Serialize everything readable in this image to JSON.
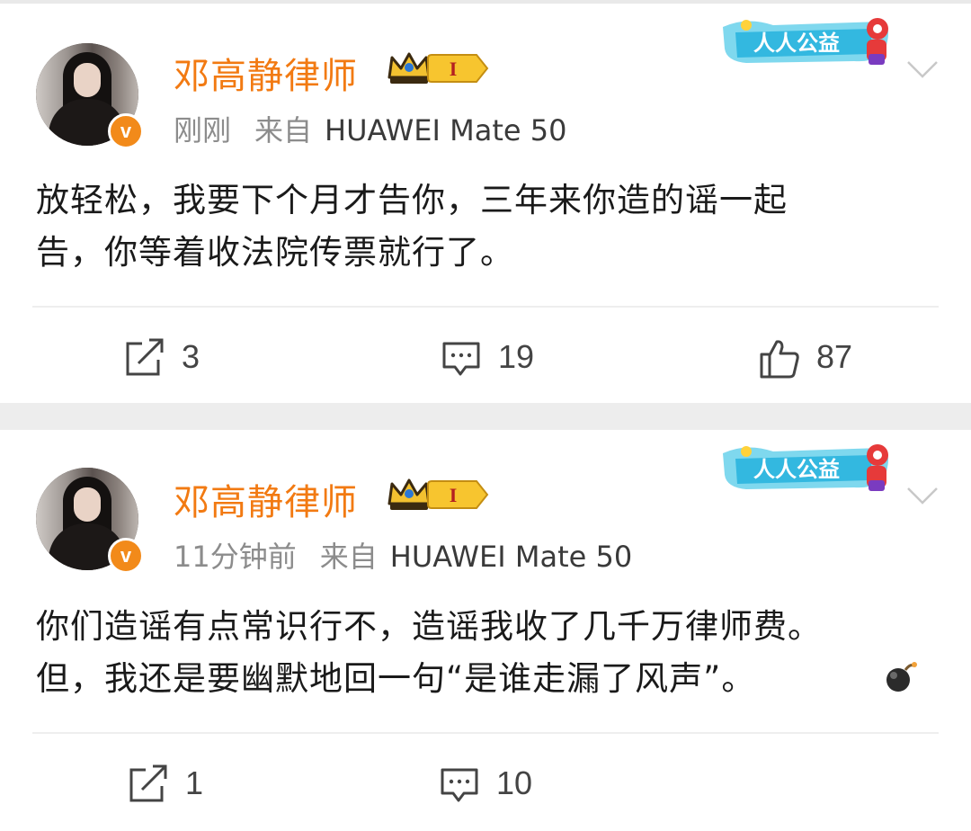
{
  "posts": [
    {
      "author": "邓高静律师",
      "level_label": "I",
      "time": "刚刚",
      "source_prefix": "来自",
      "device": "HUAWEI Mate 50",
      "charity_badge": "人人公益",
      "verified_mark": "v",
      "content_line1": "放轻松，我要下个月才告你，三年来你造的谣一起",
      "content_line2": "告，你等着收法院传票就行了。",
      "repost_count": "3",
      "comment_count": "19",
      "like_count": "87"
    },
    {
      "author": "邓高静律师",
      "level_label": "I",
      "time": "11分钟前",
      "source_prefix": "来自",
      "device": "HUAWEI Mate 50",
      "charity_badge": "人人公益",
      "verified_mark": "v",
      "content_line1": "你们造谣有点常识行不，造谣我收了几千万律师费。",
      "content_line2": "但，我还是要幽默地回一句“是谁走漏了风声”。",
      "repost_count": "1",
      "comment_count": "10"
    }
  ],
  "colors": {
    "author": "#f27a12",
    "meta": "#8c8c8c",
    "text": "#1a1a1a",
    "background": "#ededed",
    "card": "#ffffff"
  },
  "icons": [
    "repost-icon",
    "comment-icon",
    "like-icon",
    "crown-icon",
    "chevron-down-icon",
    "bomb-emoji"
  ]
}
